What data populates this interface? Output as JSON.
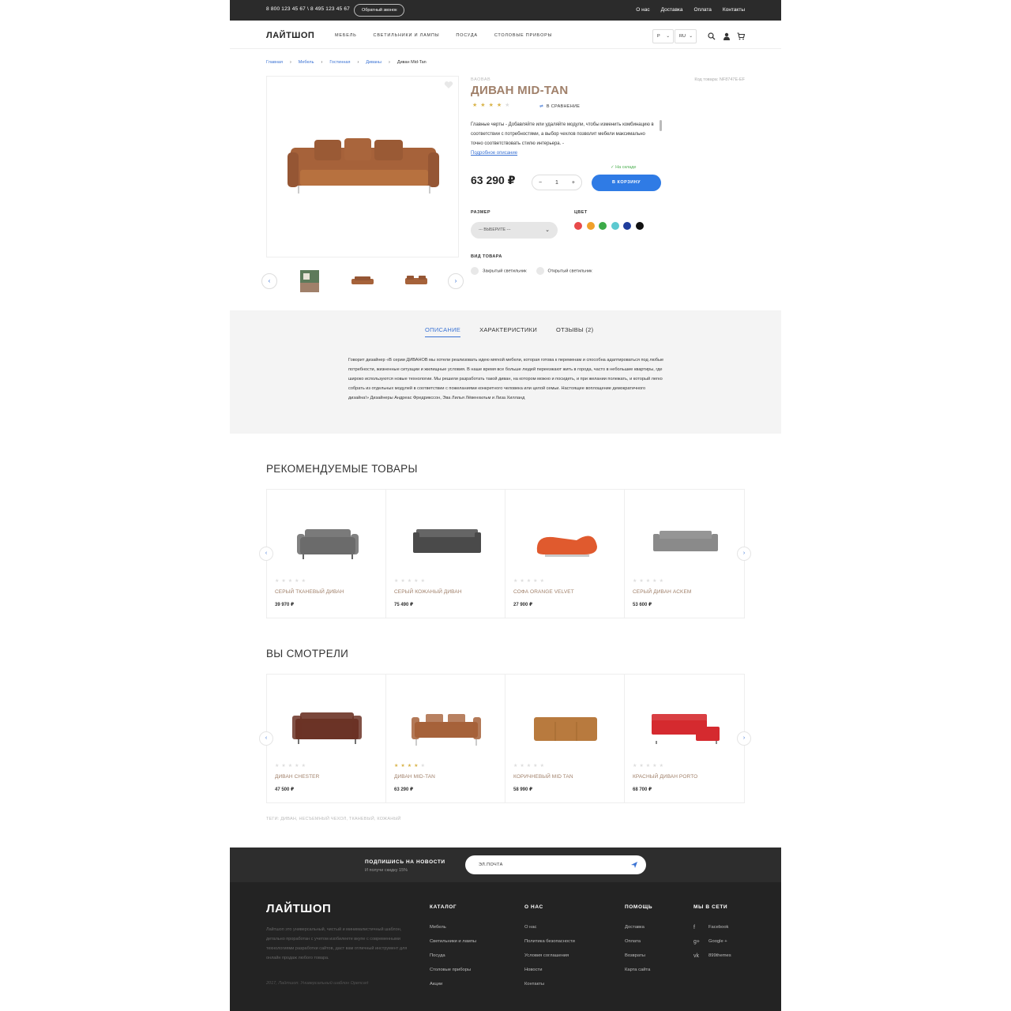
{
  "topbar": {
    "phones": "8 800 123 45 67 \\ 8 495 123 45 67",
    "callback": "Обратный звонок",
    "links": [
      "О нас",
      "Доставка",
      "Оплата",
      "Контакты"
    ]
  },
  "header": {
    "logo": "ЛАЙТШОП",
    "nav": [
      "МЕБЕЛЬ",
      "СВЕТИЛЬНИКИ И ЛАМПЫ",
      "ПОСУДА",
      "СТОЛОВЫЕ ПРИБОРЫ"
    ],
    "currency": "Р",
    "language": "RU",
    "icons": [
      "search-icon",
      "user-icon",
      "cart-icon"
    ]
  },
  "breadcrumb": [
    "Главная",
    "Мебель",
    "Гостинная",
    "Диваны",
    "Диван Mid-Tan"
  ],
  "product": {
    "brand": "BAOBAB",
    "title": "ДИВАН MID-TAN",
    "sku": "Код товара: NF8747E-EF",
    "rating": 4,
    "compare": "В СРАВНЕНИЕ",
    "short_description": "Главные черты - Добавляйте или удаляйте модули, чтобы изменить комбинацию в соответствии с потребностями, а выбор чехлов позволит мебели максимально точно соответствовать стилю интерьера. -",
    "more_link": "Подробное описание",
    "stock": "✓ На складе",
    "price": "63 290 ₽",
    "quantity": "1",
    "cart_button": "В КОРЗИНУ",
    "size_label": "РАЗМЕР",
    "size_placeholder": "--- ВЫБЕРИТЕ ---",
    "color_label": "ЦВЕТ",
    "colors": [
      "#e84a4a",
      "#f0a02a",
      "#3caa48",
      "#5cc9d0",
      "#1f3d9c",
      "#111111"
    ],
    "type_label": "ВИД ТОВАРА",
    "type_options": [
      "Закрытый светильник",
      "Открытый светильник"
    ]
  },
  "tabs": {
    "items": [
      "ОПИСАНИЕ",
      "ХАРАКТЕРИСТИКИ",
      "ОТЗЫВЫ (2)"
    ],
    "active_index": 0,
    "description": "Говорит дизайнер «В серии ДИВАНОВ мы хотели реализовать идею мягкой мебели, которая готова к переменам и способна адаптироваться под любые потребности, жизненные ситуации и жилищные условия. В наше время все больше людей переезжают жить в города, часто в небольшие квартиры, где широко используются новые технологии. Мы решили разработать такой диван, на котором можно и посидеть, и при желании полежать, и который легко собрать из отдельных модулей в соответствии с пожеланиями конкретного человека или целой семьи. Настоящее воплощение демократичного дизайна!» Дизайнеры Андреас Фредрикссон, Эва Лилья Лёвенхильм и Лиза Хилланд"
  },
  "recommended": {
    "title": "РЕКОМЕНДУЕМЫЕ ТОВАРЫ",
    "items": [
      {
        "name": "СЕРЫЙ ТКАНЕВЫЙ ДИВАН",
        "price": "39 970 ₽",
        "rating": 0,
        "color": "#6b6b6b"
      },
      {
        "name": "СЕРЫЙ КОЖАНЫЙ ДИВАН",
        "price": "75 490 ₽",
        "rating": 0,
        "color": "#4a4a4a"
      },
      {
        "name": "СОФА ORANGE VELVET",
        "price": "27 900 ₽",
        "rating": 0,
        "color": "#e05a2e"
      },
      {
        "name": "СЕРЫЙ ДИВАН ACKEM",
        "price": "53 600 ₽",
        "rating": 0,
        "color": "#8a8a8a"
      }
    ]
  },
  "viewed": {
    "title": "ВЫ СМОТРЕЛИ",
    "items": [
      {
        "name": "ДИВАН CHESTER",
        "price": "47 500 ₽",
        "rating": 0,
        "color": "#6b3326"
      },
      {
        "name": "ДИВАН MID-TAN",
        "price": "63 290 ₽",
        "rating": 4,
        "color": "#a6623a"
      },
      {
        "name": "КОРИЧНЕВЫЙ MID TAN",
        "price": "58 990 ₽",
        "rating": 0,
        "color": "#b87a3e"
      },
      {
        "name": "КРАСНЫЙ ДИВАН PORTO",
        "price": "68 700 ₽",
        "rating": 0,
        "color": "#d52a2f"
      }
    ]
  },
  "tags": "ТЕГИ: ДИВАН, НЕСЪЕМНЫЙ ЧЕХОЛ, ТКАНЕВЫЙ, КОЖАНЫЙ",
  "newsletter": {
    "title": "ПОДПИШИСЬ НА НОВОСТИ",
    "subtitle": "И получи скидку 15%",
    "placeholder": "ЭЛ.ПОЧТА"
  },
  "footer": {
    "logo": "ЛАЙТШОП",
    "about": "Лайтшоп это универсальный, чистый и минималистичный шаблон, детально проработан с учетом изобилеете вкупе с современными технологиями разработки сайтов, даст вам отличный инструмент для онлайн продаж любого товара.",
    "copyright": "2017, Лайтшоп. Универсальный шаблон Opencart",
    "columns": [
      {
        "title": "КАТАЛОГ",
        "items": [
          "Мебель",
          "Светильники и лампы",
          "Посуда",
          "Столовые приборы",
          "Акции"
        ]
      },
      {
        "title": "О НАС",
        "items": [
          "О нас",
          "Политика безопасности",
          "Условия соглашения",
          "Новости",
          "Контакты"
        ]
      },
      {
        "title": "ПОМОЩЬ",
        "items": [
          "Доставка",
          "Оплата",
          "Возвраты",
          "Карта сайта"
        ]
      }
    ],
    "social": {
      "title": "МЫ В СЕТИ",
      "items": [
        {
          "label": "Facebook",
          "icon": "facebook-icon",
          "glyph": "f"
        },
        {
          "label": "Google +",
          "icon": "google-plus-icon",
          "glyph": "g+"
        },
        {
          "label": "899themes",
          "icon": "vk-icon",
          "glyph": "vk"
        }
      ]
    }
  }
}
